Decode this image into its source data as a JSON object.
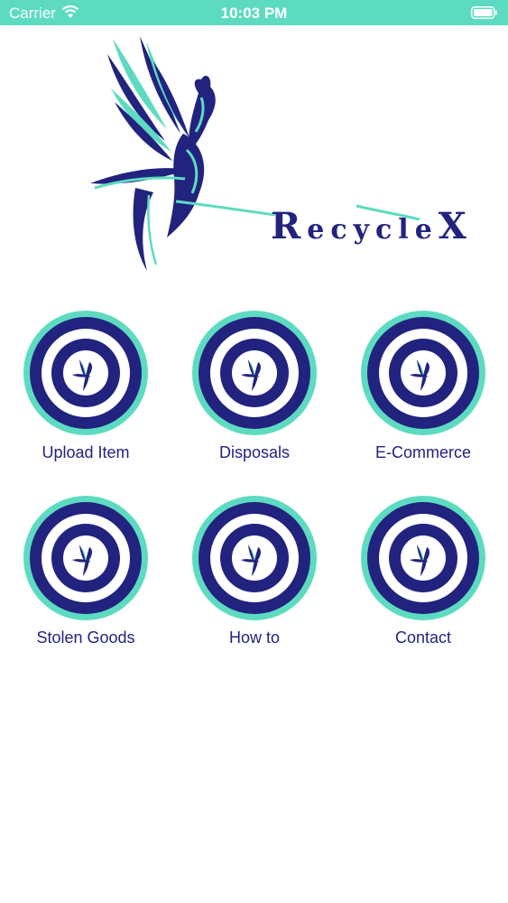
{
  "status_bar": {
    "carrier": "Carrier",
    "time": "10:03 PM"
  },
  "logo": {
    "text_lead": "R",
    "text_mid": "ecycle",
    "text_end": "X"
  },
  "menu": [
    {
      "label": "Upload Item",
      "icon": "phoenix-target-icon"
    },
    {
      "label": "Disposals",
      "icon": "phoenix-target-icon"
    },
    {
      "label": "E-Commerce",
      "icon": "phoenix-target-icon"
    },
    {
      "label": "Stolen Goods",
      "icon": "phoenix-target-icon"
    },
    {
      "label": "How to",
      "icon": "phoenix-target-icon"
    },
    {
      "label": "Contact",
      "icon": "phoenix-target-icon"
    }
  ],
  "colors": {
    "teal": "#5ddbc1",
    "navy": "#22237e",
    "white": "#ffffff"
  }
}
